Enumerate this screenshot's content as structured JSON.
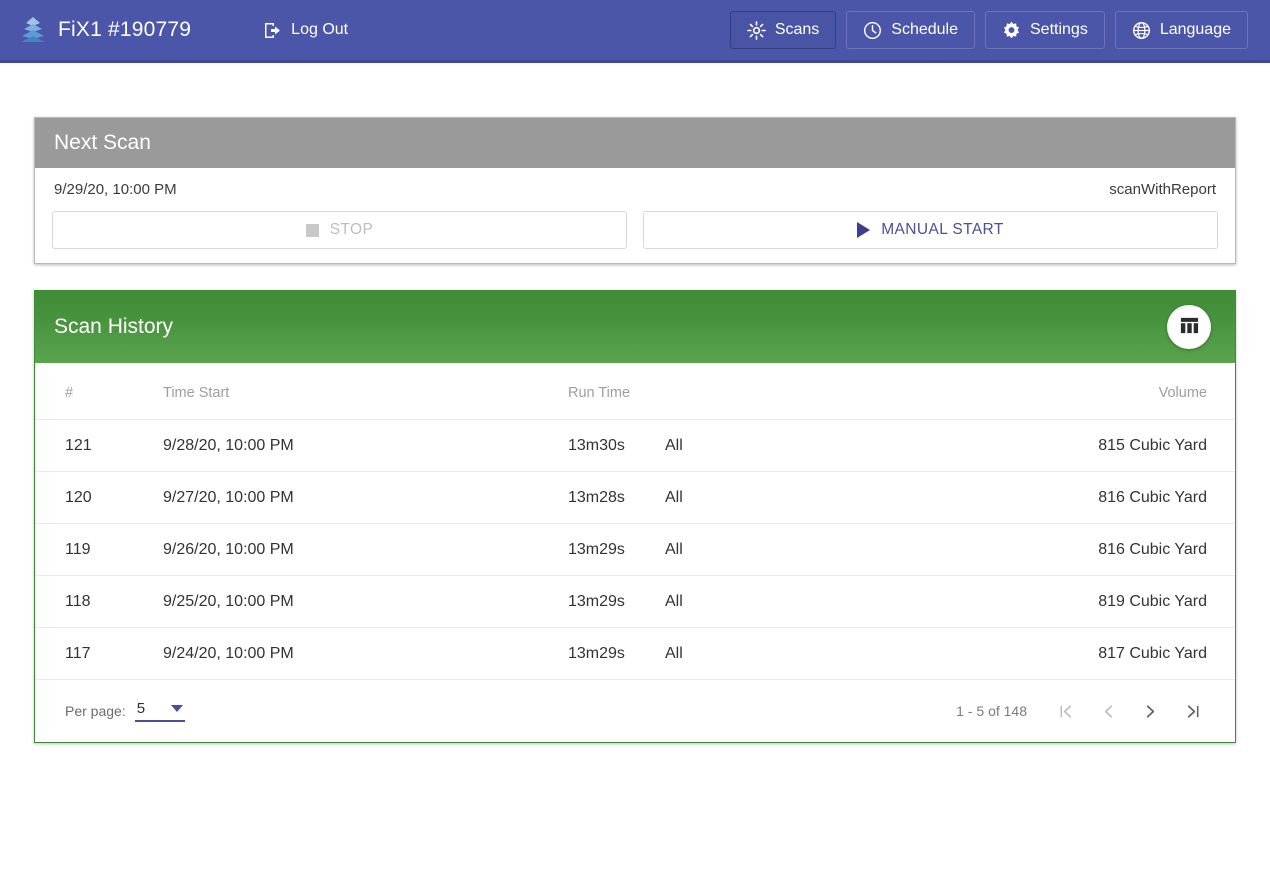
{
  "appbar": {
    "logo_icon": "stacked-layers-logo",
    "brand_title": "FiX1 #190779",
    "logout_label": "Log Out",
    "logout_icon": "logout-icon",
    "nav": [
      {
        "label": "Scans",
        "icon": "scan-burst-icon",
        "active": true
      },
      {
        "label": "Schedule",
        "icon": "clock-icon",
        "active": false
      },
      {
        "label": "Settings",
        "icon": "gear-icon",
        "active": false
      },
      {
        "label": "Language",
        "icon": "globe-icon",
        "active": false
      }
    ],
    "bar_color": "#4c56a8"
  },
  "next_scan": {
    "title": "Next Scan",
    "header_color": "#9a9a9a",
    "datetime": "9/29/20, 10:00 PM",
    "scan_type": "scanWithReport",
    "stop_label": "STOP",
    "stop_icon": "stop-square-icon",
    "stop_disabled": true,
    "start_label": "MANUAL START",
    "start_icon": "play-triangle-icon",
    "start_color": "#4a4f97"
  },
  "scan_history": {
    "title": "Scan History",
    "header_color": "#49953f",
    "columns_button_icon": "table-columns-icon",
    "columns": [
      "#",
      "Time Start",
      "Run Time",
      "",
      "Volume"
    ],
    "rows": [
      {
        "num": "121",
        "time_start": "9/28/20, 10:00 PM",
        "run_time": "13m30s",
        "scope": "All",
        "volume": "815 Cubic Yard"
      },
      {
        "num": "120",
        "time_start": "9/27/20, 10:00 PM",
        "run_time": "13m28s",
        "scope": "All",
        "volume": "816 Cubic Yard"
      },
      {
        "num": "119",
        "time_start": "9/26/20, 10:00 PM",
        "run_time": "13m29s",
        "scope": "All",
        "volume": "816 Cubic Yard"
      },
      {
        "num": "118",
        "time_start": "9/25/20, 10:00 PM",
        "run_time": "13m29s",
        "scope": "All",
        "volume": "819 Cubic Yard"
      },
      {
        "num": "117",
        "time_start": "9/24/20, 10:00 PM",
        "run_time": "13m29s",
        "scope": "All",
        "volume": "817 Cubic Yard"
      }
    ],
    "paginator": {
      "per_page_label": "Per page:",
      "per_page_value": "5",
      "range_label": "1 - 5 of 148",
      "first_icon": "first-page-icon",
      "prev_icon": "prev-page-icon",
      "next_icon": "next-page-icon",
      "last_icon": "last-page-icon"
    }
  }
}
